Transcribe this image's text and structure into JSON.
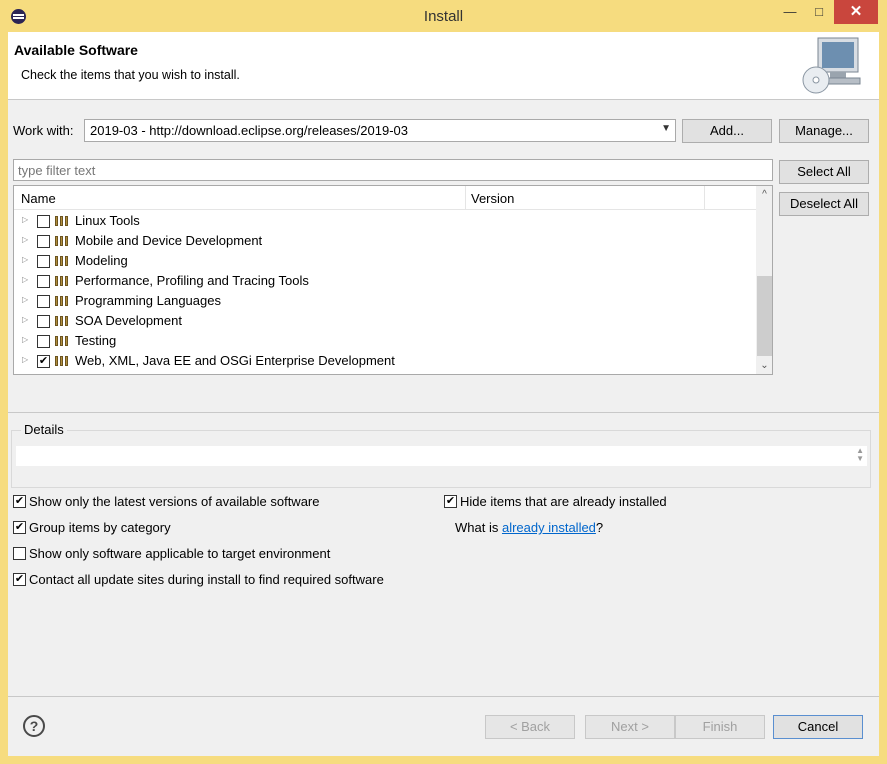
{
  "window": {
    "title": "Install",
    "minimize": "—",
    "maximize": "□",
    "close": "✕"
  },
  "header": {
    "title": "Available Software",
    "subtitle": "Check the items that you wish to install."
  },
  "work_with": {
    "label": "Work with:",
    "value": "2019-03 - http://download.eclipse.org/releases/2019-03",
    "add_button": "Add...",
    "manage_button": "Manage..."
  },
  "filter": {
    "placeholder": "type filter text"
  },
  "side_buttons": {
    "select_all": "Select All",
    "deselect_all": "Deselect All"
  },
  "tree": {
    "columns": {
      "name": "Name",
      "version": "Version"
    },
    "items": [
      {
        "label": "Linux Tools",
        "checked": false
      },
      {
        "label": "Mobile and Device Development",
        "checked": false
      },
      {
        "label": "Modeling",
        "checked": false
      },
      {
        "label": "Performance, Profiling and Tracing Tools",
        "checked": false
      },
      {
        "label": "Programming Languages",
        "checked": false
      },
      {
        "label": "SOA Development",
        "checked": false
      },
      {
        "label": "Testing",
        "checked": false
      },
      {
        "label": "Web, XML, Java EE and OSGi Enterprise Development",
        "checked": true
      }
    ]
  },
  "details": {
    "title": "Details"
  },
  "options": {
    "latest_versions": {
      "label": "Show only the latest versions of available software",
      "checked": true
    },
    "group_by_category": {
      "label": "Group items by category",
      "checked": true
    },
    "target_env": {
      "label": "Show only software applicable to target environment",
      "checked": false
    },
    "contact_sites": {
      "label": "Contact all update sites during install to find required software",
      "checked": true
    },
    "hide_installed": {
      "label": "Hide items that are already installed",
      "checked": true
    },
    "what_is_prefix": "What is ",
    "what_is_link": "already installed",
    "what_is_suffix": "?"
  },
  "footer": {
    "help": "?",
    "back": "< Back",
    "next": "Next >",
    "finish": "Finish",
    "cancel": "Cancel"
  }
}
